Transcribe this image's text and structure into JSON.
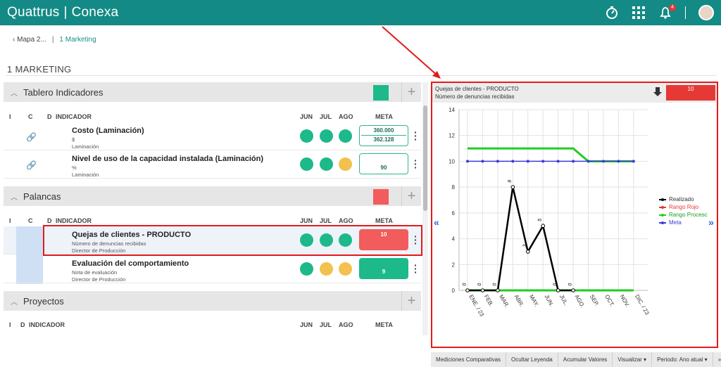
{
  "header": {
    "brand_left": "Quattrus",
    "brand_sep": "|",
    "brand_right": "Conexa",
    "notif_count": "4"
  },
  "breadcrumb": {
    "back": "Mapa 2...",
    "current": "1 Marketing"
  },
  "page_title": "1 MARKETING",
  "columns": {
    "i": "I",
    "c": "C",
    "d": "D",
    "indicator": "INDICADOR",
    "m1": "JUN",
    "m2": "JUL",
    "m3": "AGO",
    "meta": "META"
  },
  "sections": [
    {
      "name": "Tablero Indicadores",
      "color": "#1db98a"
    },
    {
      "name": "Palancas",
      "color": "#f25c5c"
    },
    {
      "name": "Proyectos"
    }
  ],
  "rows": [
    {
      "name": "Costo (Laminación)",
      "sub1": "$",
      "sub2": "Laminación",
      "meta_top": "360.000",
      "meta_bottom": "362.128",
      "dots": [
        "#1db98a",
        "#1db98a",
        "#1db98a"
      ]
    },
    {
      "name": "Nivel de uso de la capacidad instalada (Laminación)",
      "sub1": "%",
      "sub2": "Laminación",
      "meta_bottom": "90",
      "dots": [
        "#1db98a",
        "#1db98a",
        "#f2c14e"
      ]
    },
    {
      "name": "Quejas de clientes - PRODUCTO",
      "sub1": "Número de denuncias recibidas",
      "sub2": "Director de Producción",
      "meta_top": "10",
      "meta_color": "#f25c5c",
      "dots": [
        "#1db98a",
        "#1db98a",
        "#1db98a"
      ]
    },
    {
      "name": "Evaluación del comportamiento",
      "sub1": "Nota de evaluación",
      "sub2": "Director de Producción",
      "meta_bottom": "9",
      "meta_color": "#1db98a",
      "dots": [
        "#1db98a",
        "#f2c14e",
        "#f2c14e"
      ]
    }
  ],
  "chart_panel": {
    "title": "Quejas de clientes - PRODUCTO",
    "subtitle": "Número de denuncias recibidas",
    "value": "10",
    "value_color": "#e53935"
  },
  "chart_data": {
    "type": "line",
    "categories": [
      "ENE. / 23",
      "FEB.",
      "MAR.",
      "ABR.",
      "MAY.",
      "JUN.",
      "JUL.",
      "AGO.",
      "SEP.",
      "OCT.",
      "NOV.",
      "DIC. / 23"
    ],
    "ylim": [
      0,
      14
    ],
    "yticks": [
      0,
      2,
      4,
      6,
      8,
      10,
      12,
      14
    ],
    "grid": true,
    "legend_position": "right",
    "series": [
      {
        "name": "Realizado",
        "color": "#000000",
        "values": [
          0,
          0,
          0,
          8,
          3,
          5,
          0,
          0,
          null,
          null,
          null,
          null
        ],
        "labels": [
          "0",
          "0",
          "0",
          "8",
          "3",
          "5",
          "0",
          "0",
          null,
          null,
          null,
          null
        ]
      },
      {
        "name": "Rango Rojo",
        "color": "#e53935",
        "values": [
          null,
          null,
          null,
          null,
          null,
          null,
          null,
          null,
          null,
          null,
          null,
          null
        ]
      },
      {
        "name": "Rango Procesc",
        "color": "#22cc22",
        "values": [
          11,
          11,
          11,
          11,
          11,
          11,
          11,
          11,
          10,
          10,
          10,
          10
        ],
        "low_values": [
          0,
          0,
          0,
          0,
          0,
          0,
          0,
          0,
          0,
          0,
          0,
          0
        ]
      },
      {
        "name": "Meta",
        "color": "#3a3adb",
        "values": [
          10,
          10,
          10,
          10,
          10,
          10,
          10,
          10,
          10,
          10,
          10,
          10
        ]
      }
    ]
  },
  "bottom_bar": [
    "Mediciones Comparativas",
    "Ocultar Leyenda",
    "Acumular Valores",
    "Visualizar ▾",
    "Periodo: Ano atual ▾",
    "»"
  ]
}
